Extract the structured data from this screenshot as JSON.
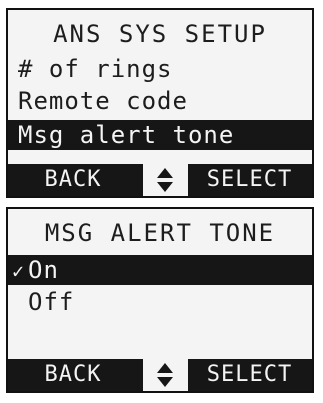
{
  "screen1": {
    "title": "ANS SYS SETUP",
    "items": [
      {
        "label": "# of rings",
        "selected": false
      },
      {
        "label": "Remote code",
        "selected": false
      },
      {
        "label": "Msg alert tone",
        "selected": true
      }
    ],
    "softkeys": {
      "left": "BACK",
      "right": "SELECT",
      "nav_icon": "up-down-arrow-icon"
    }
  },
  "screen2": {
    "title": "MSG ALERT TONE",
    "items": [
      {
        "label": "On",
        "selected": true,
        "checked": true,
        "check_mark": "✓"
      },
      {
        "label": "Off",
        "selected": false,
        "checked": false
      }
    ],
    "softkeys": {
      "left": "BACK",
      "right": "SELECT",
      "nav_icon": "up-down-arrow-icon"
    }
  },
  "colors": {
    "background": "#f4f4f4",
    "highlight": "#161616",
    "text": "#1d1d1d"
  }
}
